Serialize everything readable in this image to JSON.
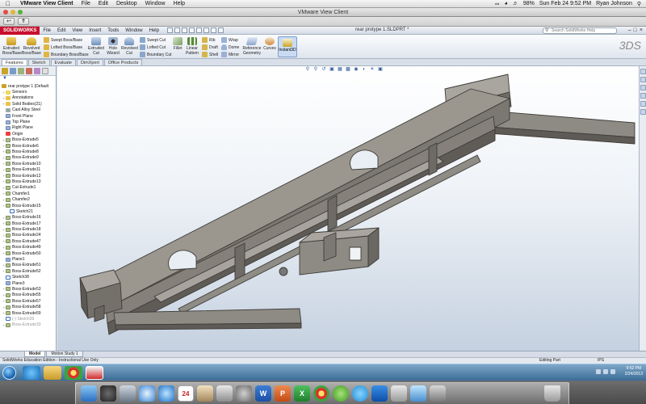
{
  "mac_menubar": {
    "app_name": "VMware View Client",
    "menus": [
      "File",
      "Edit",
      "Desktop",
      "Window",
      "Help"
    ],
    "battery": "98%",
    "datetime": "Sun Feb 24  9:52 PM",
    "user": "Ryan Johnson"
  },
  "vmware": {
    "window_title": "VMware View Client"
  },
  "solidworks": {
    "logo": "SOLIDWORKS",
    "menus": [
      "File",
      "Edit",
      "View",
      "Insert",
      "Tools",
      "Window",
      "Help"
    ],
    "doc_title": "rear protype 1.SLDPRT *",
    "search_placeholder": "Search SolidWorks Help",
    "commands": {
      "extruded_boss": "Extruded Boss/Base",
      "revolved_boss": "Revolved Boss/Base",
      "swept_boss": "Swept Boss/Base",
      "lofted_boss": "Lofted Boss/Base",
      "boundary_boss": "Boundary Boss/Base",
      "extruded_cut": "Extruded Cut",
      "hole_wizard": "Hole Wizard",
      "revolved_cut": "Revolved Cut",
      "swept_cut": "Swept Cut",
      "lofted_cut": "Lofted Cut",
      "boundary_cut": "Boundary Cut",
      "fillet": "Fillet",
      "linear_pattern": "Linear Pattern",
      "rib": "Rib",
      "draft": "Draft",
      "shell": "Shell",
      "wrap": "Wrap",
      "dome": "Dome",
      "mirror": "Mirror",
      "reference_geometry": "Reference Geometry",
      "curves": "Curves",
      "instant3d": "Instant3D"
    },
    "tabs": [
      "Features",
      "Sketch",
      "Evaluate",
      "DimXpert",
      "Office Products"
    ],
    "active_tab": "Features"
  },
  "feature_tree": {
    "root": "rear protype 1  (Default",
    "items": [
      {
        "label": "Sensors",
        "type": "sensor"
      },
      {
        "label": "Annotations",
        "type": "folder"
      },
      {
        "label": "Solid Bodies(21)",
        "type": "folder"
      },
      {
        "label": "Cast Alloy Steel",
        "type": "material"
      },
      {
        "label": "Front Plane",
        "type": "plane"
      },
      {
        "label": "Top Plane",
        "type": "plane"
      },
      {
        "label": "Right Plane",
        "type": "plane"
      },
      {
        "label": "Origin",
        "type": "origin"
      },
      {
        "label": "Boss-Extrude5",
        "type": "feature"
      },
      {
        "label": "Boss-Extrude6",
        "type": "feature"
      },
      {
        "label": "Boss-Extrude8",
        "type": "feature"
      },
      {
        "label": "Boss-Extrude9",
        "type": "feature"
      },
      {
        "label": "Boss-Extrude10",
        "type": "feature"
      },
      {
        "label": "Boss-Extrude11",
        "type": "feature"
      },
      {
        "label": "Boss-Extrude12",
        "type": "feature"
      },
      {
        "label": "Boss-Extrude13",
        "type": "feature"
      },
      {
        "label": "Cut-Extrude1",
        "type": "feature"
      },
      {
        "label": "Chamfer1",
        "type": "feature"
      },
      {
        "label": "Chamfer2",
        "type": "feature"
      },
      {
        "label": "Boss-Extrude15",
        "type": "feature"
      },
      {
        "label": "Sketch21",
        "type": "sketch",
        "indent": true
      },
      {
        "label": "Boss-Extrude16",
        "type": "feature"
      },
      {
        "label": "Boss-Extrude17",
        "type": "feature"
      },
      {
        "label": "Boss-Extrude18",
        "type": "feature"
      },
      {
        "label": "Boss-Extrude24",
        "type": "feature"
      },
      {
        "label": "Boss-Extrude47",
        "type": "feature"
      },
      {
        "label": "Boss-Extrude49",
        "type": "feature"
      },
      {
        "label": "Boss-Extrude50",
        "type": "feature"
      },
      {
        "label": "Plane1",
        "type": "plane"
      },
      {
        "label": "Boss-Extrude51",
        "type": "feature"
      },
      {
        "label": "Boss-Extrude52",
        "type": "feature"
      },
      {
        "label": "Sketch38",
        "type": "sketch"
      },
      {
        "label": "Plane3",
        "type": "plane"
      },
      {
        "label": "Boss-Extrude53",
        "type": "feature"
      },
      {
        "label": "Boss-Extrude55",
        "type": "feature"
      },
      {
        "label": "Boss-Extrude57",
        "type": "feature"
      },
      {
        "label": "Boss-Extrude58",
        "type": "feature"
      },
      {
        "label": "Boss-Extrude59",
        "type": "feature"
      },
      {
        "label": "(-) Sketch39",
        "type": "sketch",
        "faded": true
      },
      {
        "label": "Boss-Extrude33",
        "type": "feature",
        "faded": true
      }
    ]
  },
  "model_tabs": [
    "Model",
    "Motion Study 1"
  ],
  "active_model_tab": "Model",
  "status": {
    "left": "SolidWorks Education Edition - Instructional Use Only",
    "mode": "Editing Part",
    "units": "IPS"
  },
  "windows_tray": {
    "time": "9:52 PM",
    "date": "2/24/2013"
  },
  "dock_apps": [
    "finder-icon",
    "dashboard-icon",
    "mail-icon",
    "safari-icon",
    "itunes-icon",
    "ical-icon",
    "photos-icon",
    "preview-icon",
    "system-preferences-icon",
    "word-icon",
    "powerpoint-icon",
    "excel-icon",
    "chrome-icon",
    "spotify-icon",
    "skype-icon",
    "teamviewer-icon",
    "vmware-icon",
    "app-icon",
    "app-icon",
    "trash-icon"
  ],
  "colors": {
    "sw_red": "#c8102e",
    "model_gray": "#8e8a84",
    "selection_blue": "#c9dbf3"
  }
}
